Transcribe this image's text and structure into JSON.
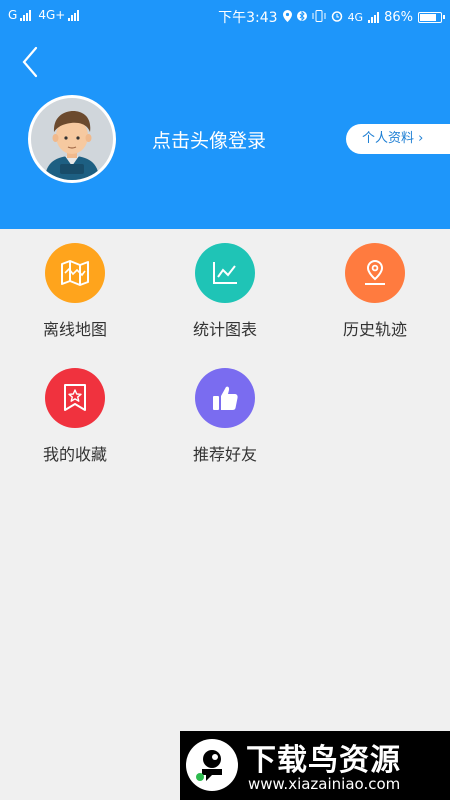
{
  "status_bar": {
    "carrier": "G",
    "network": "4G+",
    "time": "下午3:43",
    "network2": "4G",
    "battery": "86%",
    "battery_level": 0.86
  },
  "header": {
    "login_prompt": "点击头像登录",
    "profile_button": "个人资料 ›"
  },
  "menu": {
    "items": [
      {
        "label": "离线地图",
        "icon": "map-icon",
        "color": "#ffa41c"
      },
      {
        "label": "统计图表",
        "icon": "line-chart-icon",
        "color": "#1fc4b6"
      },
      {
        "label": "历史轨迹",
        "icon": "location-pin-icon",
        "color": "#ff7b3f"
      },
      {
        "label": "我的收藏",
        "icon": "bookmark-star-icon",
        "color": "#f0323e"
      },
      {
        "label": "推荐好友",
        "icon": "thumbs-up-icon",
        "color": "#7a6cf0"
      }
    ]
  },
  "watermark": {
    "title": "下载鸟资源",
    "url": "www.xiazainiao.com"
  },
  "colors": {
    "header_bg": "#1e96fa",
    "page_bg": "#f0f0f0"
  }
}
